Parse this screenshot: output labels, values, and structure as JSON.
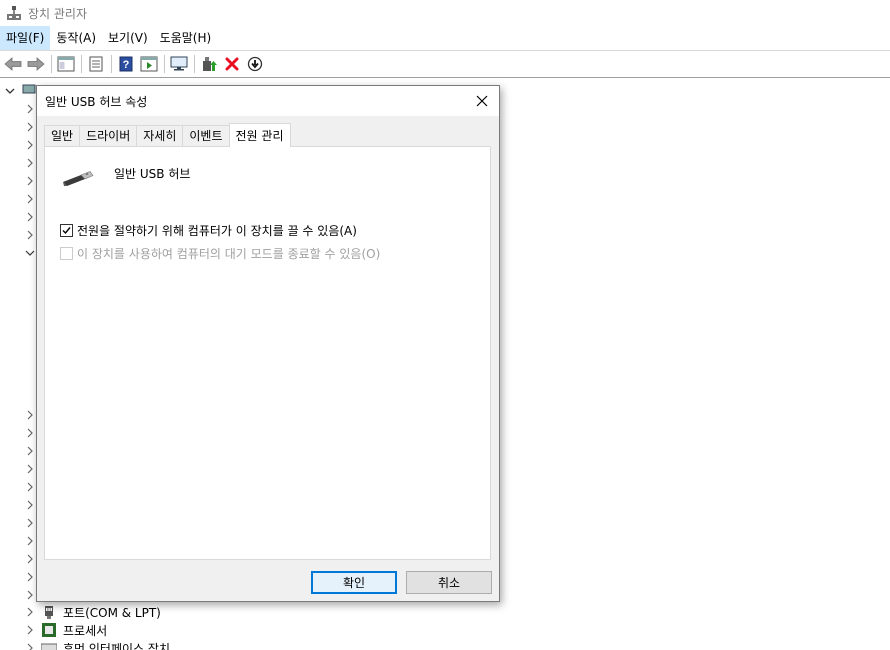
{
  "window": {
    "title": "장치 관리자"
  },
  "menu": {
    "items": [
      {
        "label": "파일(F)"
      },
      {
        "label": "동작(A)"
      },
      {
        "label": "보기(V)"
      },
      {
        "label": "도움말(H)"
      }
    ]
  },
  "tree": {
    "items": [
      {
        "label": "포트(COM & LPT)"
      },
      {
        "label": "프로세서"
      },
      {
        "label": "휴먼 인터페이스 장치"
      }
    ]
  },
  "dialog": {
    "title": "일반 USB 허브 속성",
    "tabs": [
      {
        "label": "일반"
      },
      {
        "label": "드라이버"
      },
      {
        "label": "자세히"
      },
      {
        "label": "이벤트"
      },
      {
        "label": "전원 관리"
      }
    ],
    "device_name": "일반 USB 허브",
    "options": [
      {
        "label": "전원을 절약하기 위해 컴퓨터가 이 장치를 끌 수 있음(A)",
        "checked": true,
        "enabled": true
      },
      {
        "label": "이 장치를 사용하여 컴퓨터의 대기 모드를 종료할 수 있음(O)",
        "checked": false,
        "enabled": false
      }
    ],
    "ok_label": "확인",
    "cancel_label": "취소"
  },
  "colors": {
    "accent": "#0078d7",
    "menu_highlight": "#cce8ff",
    "delete_red": "#e81123"
  }
}
